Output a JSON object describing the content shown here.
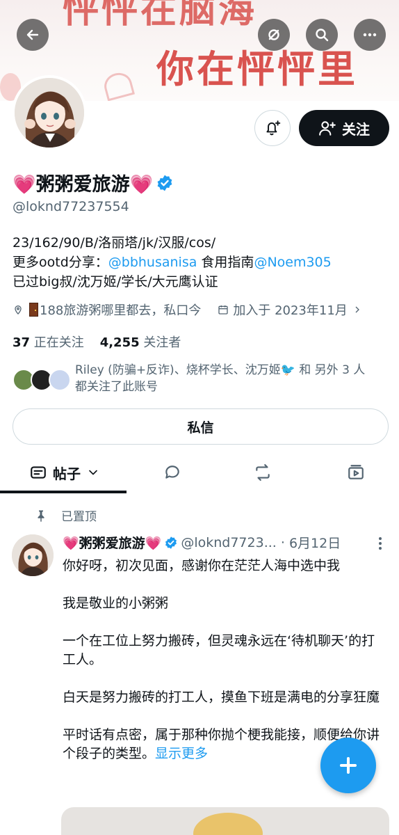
{
  "banner": {
    "text_line1": "怦怦在脑海",
    "text_line2": "你在怦怦里"
  },
  "header_buttons": {
    "back": "back-arrow-icon",
    "hide": "eye-slash-icon",
    "search": "search-icon",
    "more": "more-icon"
  },
  "profile": {
    "display_name": "💗粥粥爱旅游💗",
    "handle": "@loknd77237554",
    "bio_line1": "23/162/90/B/洛丽塔/jk/汉服/cos/",
    "bio_line2_prefix": "更多ootd分享：",
    "bio_line2_link1": "@bbhusanisa",
    "bio_line2_mid": " 食用指南",
    "bio_line2_link2": "@Noem305",
    "bio_line3": "已过big叔/沈万姬/学长/大元鹰认证",
    "location": "188旅游粥哪里都去，私口今",
    "joined": "加入于 2023年11月",
    "following_count": "37",
    "following_label": "正在关注",
    "followers_count": "4,255",
    "followers_label": "关注者",
    "known_followers_line1": "Riley (防骗+反诈)、烧杯学长、沈万姬🐦 和 另外 3 人",
    "known_followers_line2": "都关注了此账号",
    "follow_label": "关注",
    "dm_label": "私信"
  },
  "tabs": {
    "posts_label": "帖子"
  },
  "pinned_label": "已置顶",
  "post": {
    "name": "💗粥粥爱旅游💗",
    "handle": "@loknd7723...",
    "date": "6月12日",
    "p1": "你好呀，初次见面，感谢你在茫茫人海中选中我",
    "p2": "我是敬业的小粥粥",
    "p3": "一个在工位上努力搬砖，但灵魂永远在‘待机聊天’的打工人。",
    "p4": "白天是努力搬砖的打工人，摸鱼下班是满电的分享狂魔",
    "p5": "平时话有点密，属于那种你抛个梗我能接，顺便给你讲个段子的类型。",
    "show_more": "显示更多"
  },
  "colors": {
    "accent": "#1d9bf0",
    "text": "#0f1419",
    "secondary": "#536471",
    "verified": "#1d9bf0"
  }
}
